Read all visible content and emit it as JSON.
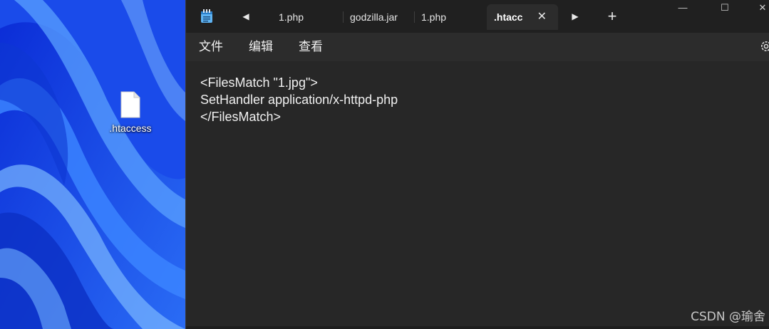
{
  "desktop": {
    "icon_label": ".htaccess"
  },
  "tabs": [
    {
      "label": "1.php"
    },
    {
      "label": "godzilla.jar"
    },
    {
      "label": "1.php"
    },
    {
      "label": ".htacc",
      "active": true
    }
  ],
  "tab_controls": {
    "prev": "◀",
    "next": "▶",
    "new_tab": "+",
    "close": "✕"
  },
  "window_controls": {
    "minimize": "—",
    "maximize": "☐",
    "close": "✕"
  },
  "menu": {
    "file": "文件",
    "edit": "编辑",
    "view": "查看"
  },
  "editor": {
    "lines": [
      "<FilesMatch \"1.jpg\">",
      "SetHandler application/x-httpd-php",
      "</FilesMatch>"
    ]
  },
  "watermark": "CSDN @瑜舍",
  "colors": {
    "wallpaper": "#1747e0",
    "window_bg": "#272727",
    "tabbar_bg": "#202020",
    "menubar_bg": "#2c2c2c"
  },
  "icons": [
    "notepad-app-icon",
    "file-icon",
    "settings-gear-icon"
  ]
}
